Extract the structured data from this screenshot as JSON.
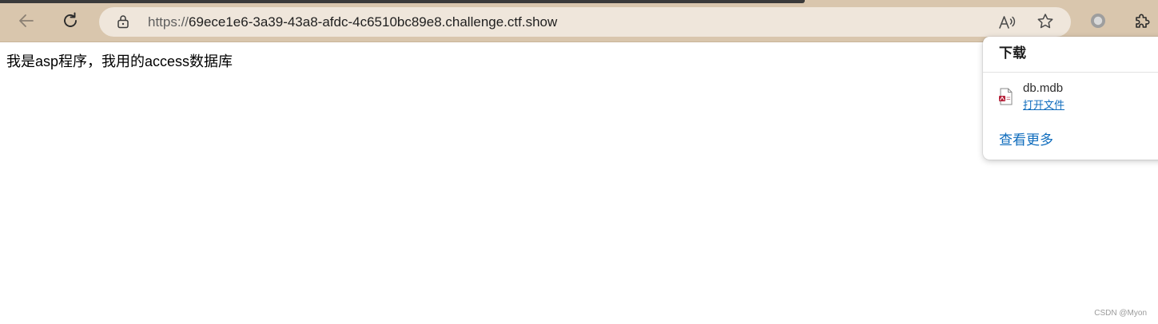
{
  "browser": {
    "url_scheme": "https://",
    "url_host": "69ece1e6-3a39-43a8-afdc-4c6510bc89e8.challenge.ctf.show",
    "icons": {
      "back": "back-arrow-icon",
      "reload": "reload-icon",
      "site_info": "lock-icon",
      "read_aloud": "read-aloud-icon",
      "favorite": "star-icon",
      "profile": "profile-icon",
      "extensions": "puzzle-icon"
    }
  },
  "page": {
    "body_text": "我是asp程序，我用的access数据库"
  },
  "downloads": {
    "title": "下载",
    "items": [
      {
        "file_name": "db.mdb",
        "action_label": "打开文件",
        "icon": "file-icon"
      }
    ],
    "see_more_label": "查看更多"
  },
  "watermark": {
    "text": "CSDN @Myon⁠"
  },
  "colors": {
    "toolbar": "#d9c6ad",
    "address_bar": "#efe6db",
    "link": "#0f6cbd"
  }
}
